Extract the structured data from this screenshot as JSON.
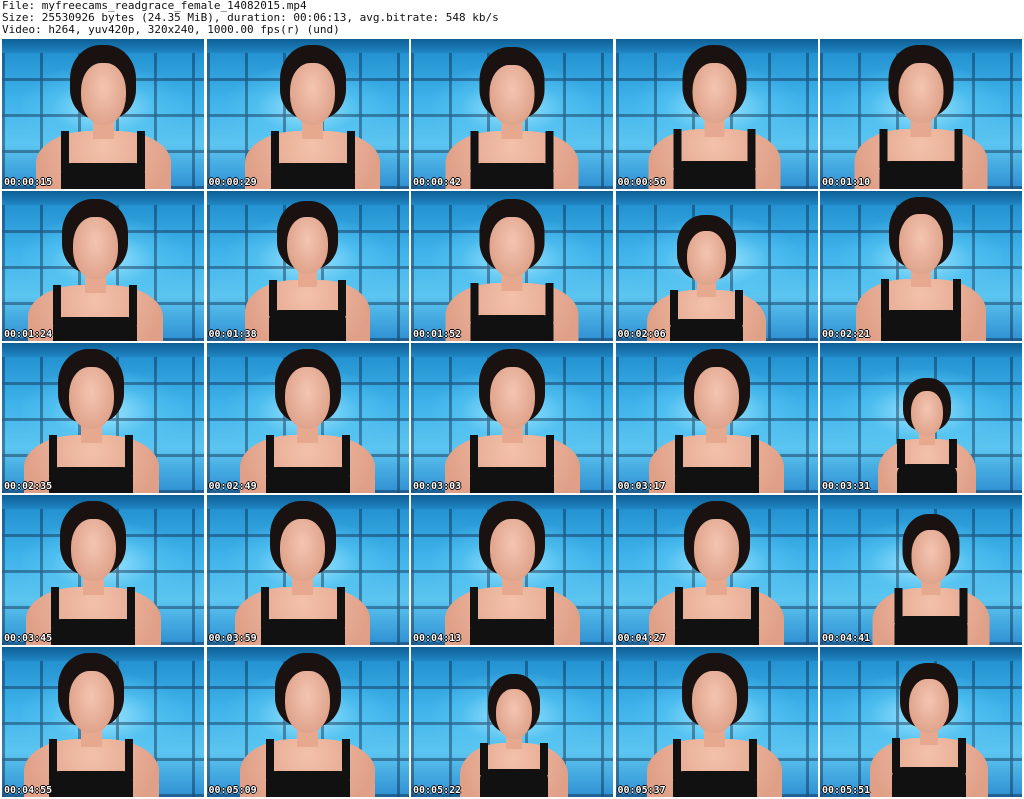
{
  "header": {
    "file_line": "File: myfreecams_readgrace_female_14082015.mp4",
    "size_line": "Size: 25530926 bytes (24.35 MiB), duration: 00:06:13, avg.bitrate: 548 kb/s",
    "video_line": "Video: h264, yuv420p, 320x240, 1000.00 fps(r) (und)"
  },
  "thumbnails": [
    {
      "timestamp": "00:00:15"
    },
    {
      "timestamp": "00:00:29"
    },
    {
      "timestamp": "00:00:42"
    },
    {
      "timestamp": "00:00:56"
    },
    {
      "timestamp": "00:01:10"
    },
    {
      "timestamp": "00:01:24"
    },
    {
      "timestamp": "00:01:38"
    },
    {
      "timestamp": "00:01:52"
    },
    {
      "timestamp": "00:02:06"
    },
    {
      "timestamp": "00:02:21"
    },
    {
      "timestamp": "00:02:35"
    },
    {
      "timestamp": "00:02:49"
    },
    {
      "timestamp": "00:03:03"
    },
    {
      "timestamp": "00:03:17"
    },
    {
      "timestamp": "00:03:31"
    },
    {
      "timestamp": "00:03:45"
    },
    {
      "timestamp": "00:03:59"
    },
    {
      "timestamp": "00:04:13"
    },
    {
      "timestamp": "00:04:27"
    },
    {
      "timestamp": "00:04:41"
    },
    {
      "timestamp": "00:04:55"
    },
    {
      "timestamp": "00:05:09"
    },
    {
      "timestamp": "00:05:22"
    },
    {
      "timestamp": "00:05:37"
    },
    {
      "timestamp": "00:05:51"
    }
  ]
}
